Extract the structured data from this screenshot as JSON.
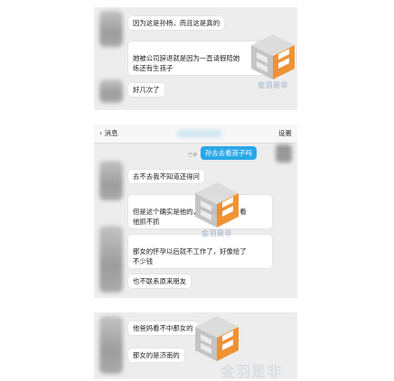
{
  "screenshot1": {
    "messages": [
      "因为这是孙杨，而且这是真的",
      "她被公司辞退就是因为一直请假陪她\n练还有生孩子",
      "好几次了"
    ]
  },
  "screenshot2": {
    "nav": {
      "back_label": "消息",
      "settings_label": "设置"
    },
    "outgoing": "孙去去看孩子吗",
    "timestamp": "已读",
    "messages": [
      "去不去我不知道还得问",
      "但是这个确实是他的，你可以问问，看\n他抓不抓",
      "那女的怀孕以后就不工作了，好像给了\n不少钱",
      "也不联系原来朋友"
    ]
  },
  "screenshot3": {
    "messages": [
      "他爸妈看不中那女的",
      "那女的是济南的"
    ]
  },
  "watermark": {
    "label": "金羽是非",
    "icon": "cube-logo-watermark"
  },
  "colors": {
    "outgoing_bubble": "#29a7e8",
    "chat_background": "#ededed",
    "watermark_orange": "#f08a24"
  }
}
